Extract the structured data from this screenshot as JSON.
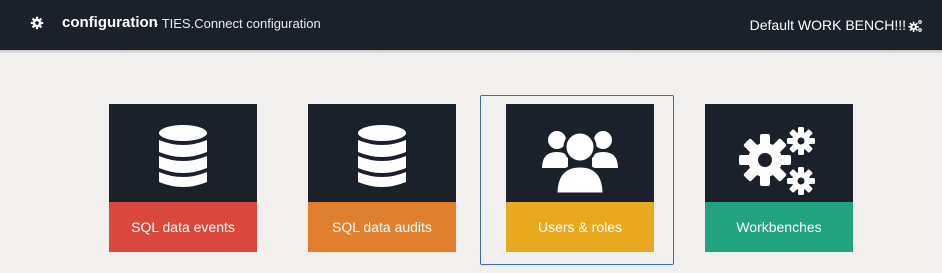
{
  "header": {
    "title": "configuration",
    "subtitle": "- TIES.Connect configuration",
    "workbench_label": "Default WORK BENCH!!!"
  },
  "tiles": [
    {
      "label": "SQL data events",
      "icon": "database-icon",
      "color": "#d9473d"
    },
    {
      "label": "SQL data audits",
      "icon": "database-icon",
      "color": "#e0802f"
    },
    {
      "label": "Users & roles",
      "icon": "users-icon",
      "color": "#e8a820",
      "selected": true
    },
    {
      "label": "Workbenches",
      "icon": "gears-icon",
      "color": "#21a37f"
    }
  ],
  "colors": {
    "header_bg": "#1b212a",
    "page_bg": "#f1f0ee",
    "selection": "#3a6bc4"
  }
}
